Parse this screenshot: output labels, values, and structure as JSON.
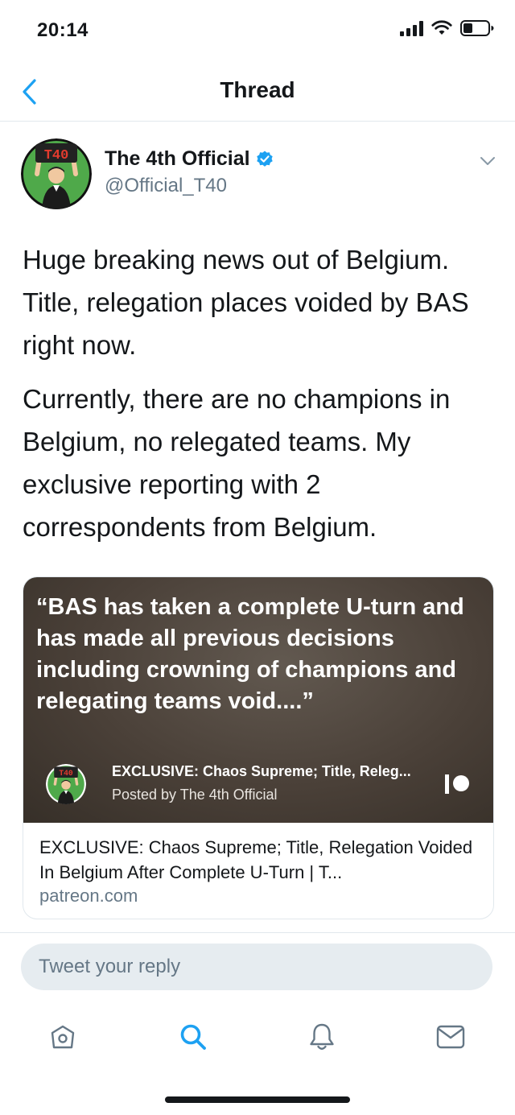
{
  "status_bar": {
    "time": "20:14"
  },
  "nav": {
    "title": "Thread"
  },
  "tweet": {
    "author_name": "The 4th Official",
    "author_handle": "@Official_T40",
    "avatar_sign_text": "T40",
    "paragraphs": [
      "Huge breaking news out of Belgium. Title, relegation places voided by BAS right now.",
      "Currently, there are no champions in Belgium, no relegated teams. My exclusive reporting with 2 correspondents from Belgium."
    ]
  },
  "card": {
    "quote": "“BAS has taken a complete U-turn and has made all previous decisions including crowning of champions and relegating teams void....”",
    "mini_title": "EXCLUSIVE: Chaos Supreme; Title, Releg...",
    "mini_subtitle": "Posted by The 4th Official",
    "title": "EXCLUSIVE: Chaos Supreme; Title, Relegation Voided In Belgium After Complete U-Turn | T...",
    "domain": "patreon.com"
  },
  "reply": {
    "placeholder": "Tweet your reply"
  },
  "tabs": [
    {
      "icon": "home-icon"
    },
    {
      "icon": "search-icon"
    },
    {
      "icon": "notifications-bell-icon"
    },
    {
      "icon": "messages-envelope-icon"
    }
  ],
  "colors": {
    "accent": "#1da1f2",
    "text_primary": "#14171a",
    "text_secondary": "#657786",
    "divider": "#e1e8ed",
    "avatar_green": "#4fa94a"
  }
}
